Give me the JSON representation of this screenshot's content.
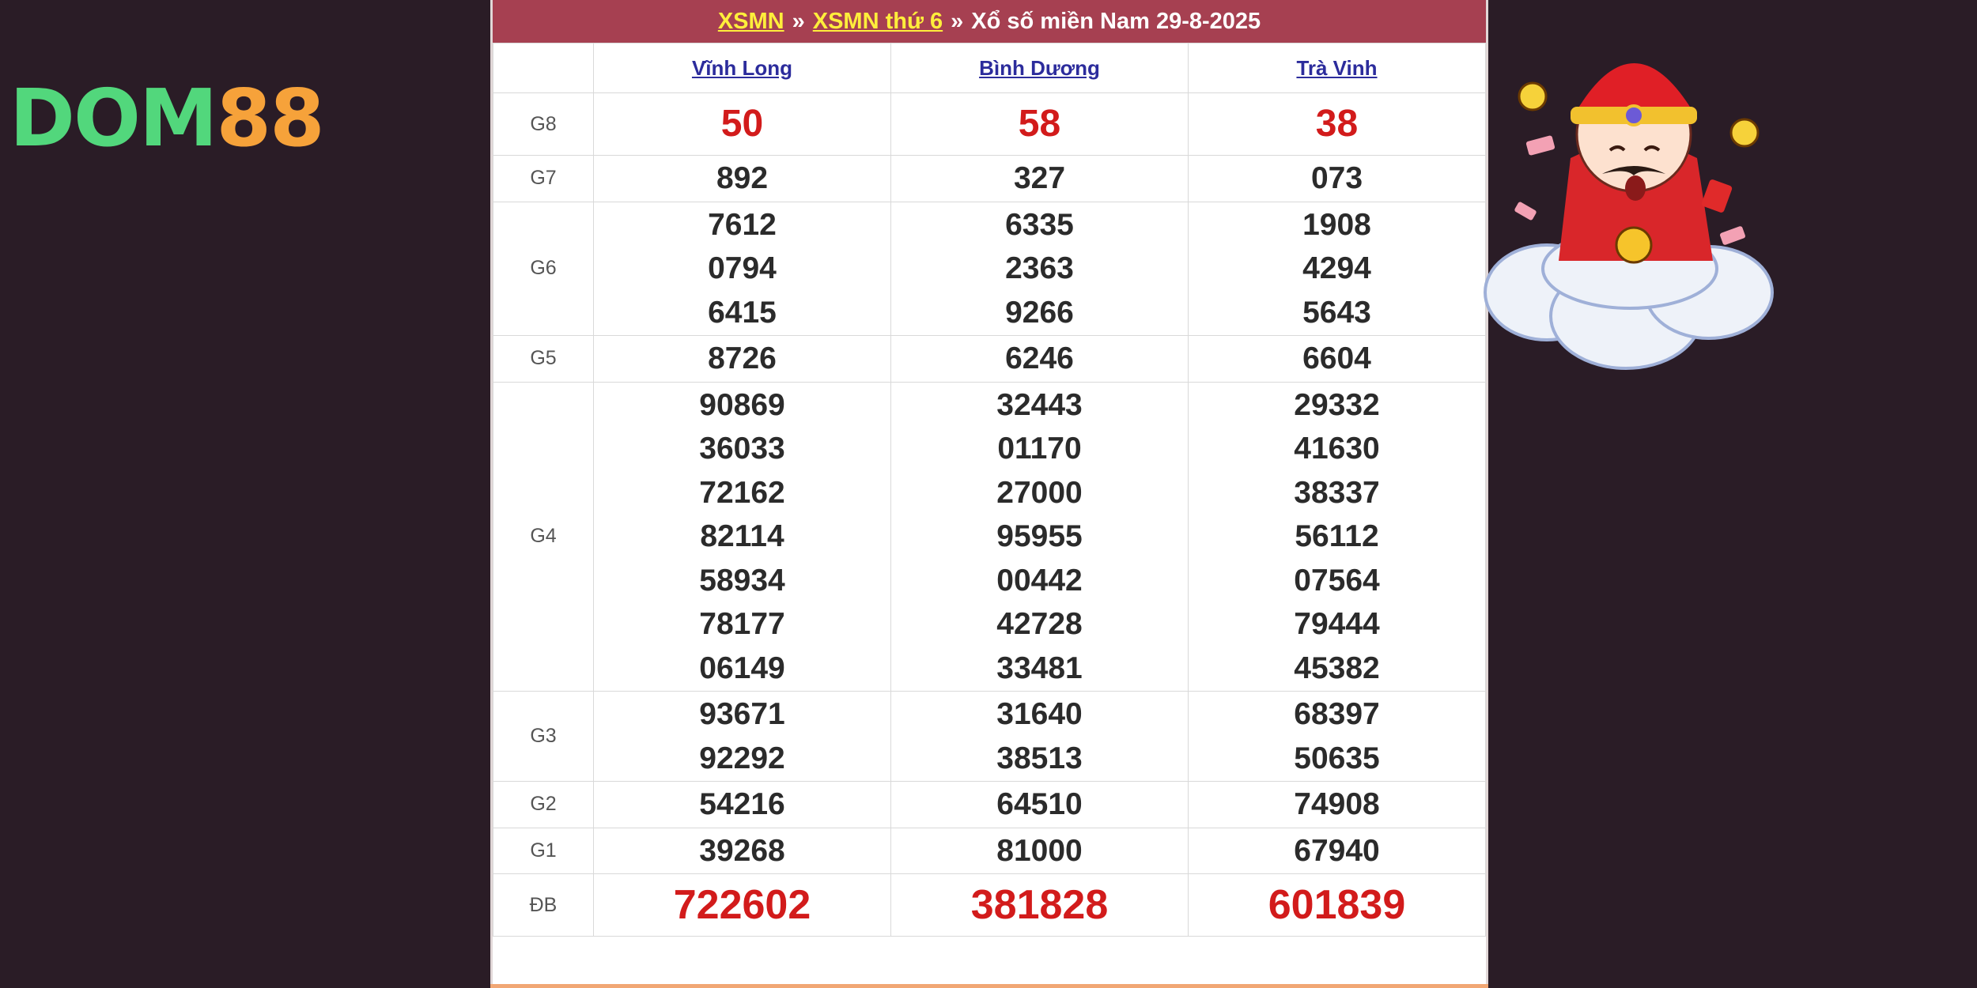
{
  "logo": {
    "part1": "DOM",
    "part2": "88"
  },
  "header": {
    "crumb1": "XSMN",
    "sep1": "»",
    "crumb2": "XSMN thứ 6",
    "sep2": "»",
    "title": "Xổ số miền Nam 29-8-2025"
  },
  "provinces": [
    "Vĩnh Long",
    "Bình Dương",
    "Trà Vinh"
  ],
  "prizes": [
    {
      "label": "G8",
      "values": [
        [
          "50"
        ],
        [
          "58"
        ],
        [
          "38"
        ]
      ]
    },
    {
      "label": "G7",
      "values": [
        [
          "892"
        ],
        [
          "327"
        ],
        [
          "073"
        ]
      ]
    },
    {
      "label": "G6",
      "values": [
        [
          "7612",
          "0794",
          "6415"
        ],
        [
          "6335",
          "2363",
          "9266"
        ],
        [
          "1908",
          "4294",
          "5643"
        ]
      ]
    },
    {
      "label": "G5",
      "values": [
        [
          "8726"
        ],
        [
          "6246"
        ],
        [
          "6604"
        ]
      ]
    },
    {
      "label": "G4",
      "values": [
        [
          "90869",
          "36033",
          "72162",
          "82114",
          "58934",
          "78177",
          "06149"
        ],
        [
          "32443",
          "01170",
          "27000",
          "95955",
          "00442",
          "42728",
          "33481"
        ],
        [
          "29332",
          "41630",
          "38337",
          "56112",
          "07564",
          "79444",
          "45382"
        ]
      ]
    },
    {
      "label": "G3",
      "values": [
        [
          "93671",
          "92292"
        ],
        [
          "31640",
          "38513"
        ],
        [
          "68397",
          "50635"
        ]
      ]
    },
    {
      "label": "G2",
      "values": [
        [
          "54216"
        ],
        [
          "64510"
        ],
        [
          "74908"
        ]
      ]
    },
    {
      "label": "G1",
      "values": [
        [
          "39268"
        ],
        [
          "81000"
        ],
        [
          "67940"
        ]
      ]
    },
    {
      "label": "ĐB",
      "values": [
        [
          "722602"
        ],
        [
          "381828"
        ],
        [
          "601839"
        ]
      ]
    }
  ],
  "colors": {
    "background": "#2a1c26",
    "title_bar": "#a64051",
    "crumb": "#ffee3b",
    "highlight": "#d21b1b"
  }
}
